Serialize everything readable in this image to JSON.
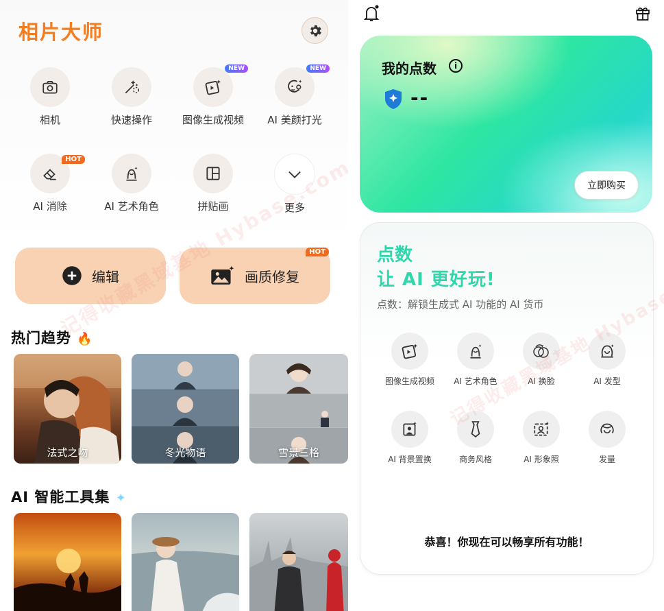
{
  "app_title": "相片大师",
  "tools": [
    {
      "label": "相机",
      "icon": "camera-icon"
    },
    {
      "label": "快速操作",
      "icon": "magic-wand-icon"
    },
    {
      "label": "图像生成视频",
      "icon": "image-to-video-icon",
      "badge": "NEW"
    },
    {
      "label": "AI 美颜打光",
      "icon": "face-light-icon",
      "badge": "NEW"
    },
    {
      "label": "AI 消除",
      "icon": "eraser-icon",
      "badge": "HOT"
    },
    {
      "label": "AI 艺术角色",
      "icon": "art-character-icon"
    },
    {
      "label": "拼贴画",
      "icon": "collage-icon"
    },
    {
      "label": "更多",
      "icon": "chevron-down-icon"
    }
  ],
  "actions": {
    "edit": "编辑",
    "enhance": "画质修复",
    "enhance_badge": "HOT"
  },
  "trending": {
    "title": "热门趋势",
    "items": [
      "法式之吻",
      "冬光物语",
      "雪景三格"
    ]
  },
  "ai_tools": {
    "title": "AI 智能工具集"
  },
  "points": {
    "title": "我的点数",
    "info": "i",
    "value": "--",
    "buy": "立即购买"
  },
  "info": {
    "h1": "点数",
    "h2": "让 AI 更好玩!",
    "sub": "点数：解锁生成式 AI 功能的 AI 货币",
    "features": [
      "图像生成视频",
      "AI 艺术角色",
      "AI 换脸",
      "AI 发型",
      "AI 背景置换",
      "商务风格",
      "AI 形象照",
      "发量"
    ],
    "congrats": "恭喜！你现在可以畅享所有功能！"
  },
  "watermark": {
    "cn": "记得收藏黑域基地",
    "en": "Hybase.com"
  },
  "colors": {
    "brand": "#f57c1f",
    "accent": "#2ed8ac",
    "action_bg": "#f8d2b2"
  }
}
